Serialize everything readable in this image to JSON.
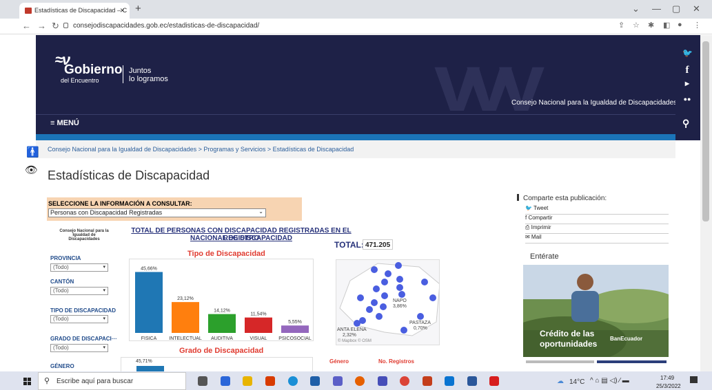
{
  "browser": {
    "tab_title": "Estadísticas de Discapacidad – C",
    "tab_close": "×",
    "new_tab": "+",
    "url": "consejodiscapacidades.gob.ec/estadisticas-de-discapacidad/"
  },
  "header": {
    "logo_main": "Gobierno",
    "logo_sub": "del Encuentro",
    "tagline1": "Juntos",
    "tagline2": "lo logramos",
    "org_name": "Consejo Nacional para la Igualdad de Discapacidades",
    "menu_label": "≡ MENÚ"
  },
  "breadcrumb": "Consejo Nacional para la Igualdad de Discapacidades > Programas y Servicios > Estadísticas de Discapacidad",
  "page_title": "Estadísticas de Discapacidad",
  "selector": {
    "label": "SELECCIONE LA INFORMACIÓN A CONSULTAR:",
    "value": "Personas con Discapacidad Registradas"
  },
  "dashboard": {
    "org_caption": "Consejo Nacional para la Igualdad de Discapacidades",
    "title_line1": "TOTAL DE PERSONAS CON DISCAPACIDAD REGISTRADAS EN EL REGISTRO",
    "title_line2": "NACIONAL DE DISCAPACIDAD",
    "total_label": "TOTAL:",
    "total_value": "471.205",
    "filters": [
      {
        "label": "PROVINCIA",
        "value": "(Todo)"
      },
      {
        "label": "CANTÓN",
        "value": "(Todo)"
      },
      {
        "label": "TIPO DE DISCAPACIDAD",
        "value": "(Todo)"
      },
      {
        "label": "GRADO DE DISCAPACI···",
        "value": "(Todo)"
      },
      {
        "label": "GÉNERO",
        "value": ""
      }
    ],
    "chart1_title": "Tipo de Discapacidad",
    "chart2_title": "Grado de Discapacidad",
    "chart2_first_label": "45,71%",
    "map_labels": [
      "NAPO",
      "3,86%",
      "PASTAZA",
      "0,70%",
      "ANTA ELENA",
      "2,32%",
      "© Mapbox © OSM"
    ],
    "gender_header": "Género",
    "records_header": "No. Registros"
  },
  "chart_data": {
    "type": "bar",
    "title": "Tipo de Discapacidad",
    "categories": [
      "FISICA",
      "INTELECTUAL",
      "AUDITIVA",
      "VISUAL",
      "PSICOSOCIAL"
    ],
    "values": [
      45.66,
      23.12,
      14.12,
      11.54,
      5.55
    ],
    "labels": [
      "45,66%",
      "23,12%",
      "14,12%",
      "11,54%",
      "5,55%"
    ],
    "colors": [
      "#1f77b4",
      "#ff7f0e",
      "#2ca02c",
      "#d62728",
      "#9467bd"
    ],
    "ylim": [
      0,
      50
    ]
  },
  "sidebar": {
    "share_title": "Comparte esta publicación:",
    "share_items": [
      "🐦 Tweet",
      "f Compartir",
      "⎙ Imprimir",
      "✉ Mail"
    ],
    "enterate": "Entérate",
    "promo_line1": "Crédito de las",
    "promo_line2": "oportunidades",
    "promo_bank": "BanEcuador"
  },
  "taskbar": {
    "search_placeholder": "Escribe aquí para buscar",
    "weather": "14°C",
    "time": "17:49",
    "date": "25/3/2022"
  }
}
